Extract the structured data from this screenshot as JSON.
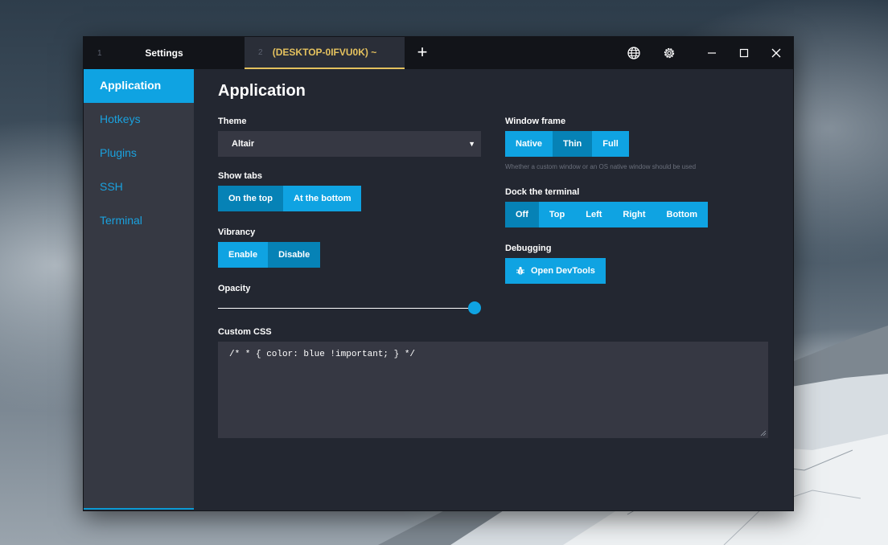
{
  "tabs": [
    {
      "number": "1",
      "label": "Settings"
    },
    {
      "number": "2",
      "label": "(DESKTOP-0IFVU0K) ~"
    }
  ],
  "titlebar": {
    "add_tab_icon": "+",
    "icons": [
      "globe-icon",
      "gear-icon",
      "minimize-icon",
      "maximize-icon",
      "close-icon"
    ]
  },
  "sidebar": {
    "items": [
      {
        "label": "Application",
        "active": true
      },
      {
        "label": "Hotkeys"
      },
      {
        "label": "Plugins"
      },
      {
        "label": "SSH"
      },
      {
        "label": "Terminal"
      }
    ]
  },
  "page": {
    "title": "Application",
    "theme": {
      "label": "Theme",
      "value": "Altair"
    },
    "show_tabs": {
      "label": "Show tabs",
      "options": [
        "On the top",
        "At the bottom"
      ],
      "selected": "On the top"
    },
    "vibrancy": {
      "label": "Vibrancy",
      "options": [
        "Enable",
        "Disable"
      ],
      "selected": "Disable"
    },
    "opacity": {
      "label": "Opacity",
      "value": 1.0
    },
    "window_frame": {
      "label": "Window frame",
      "options": [
        "Native",
        "Thin",
        "Full"
      ],
      "selected": "Thin",
      "hint": "Whether a custom window or an OS native window should be used"
    },
    "dock": {
      "label": "Dock the terminal",
      "options": [
        "Off",
        "Top",
        "Left",
        "Right",
        "Bottom"
      ],
      "selected": "Off"
    },
    "debugging": {
      "label": "Debugging",
      "button": "Open DevTools",
      "icon": "bug-icon"
    },
    "custom_css": {
      "label": "Custom CSS",
      "value": "/* * { color: blue !important; } */"
    }
  },
  "colors": {
    "accent": "#0fa3e2",
    "accent_selected": "#0682b6",
    "active_tab": "#e4c15e",
    "background": "#232731",
    "sidebar": "#363943"
  }
}
